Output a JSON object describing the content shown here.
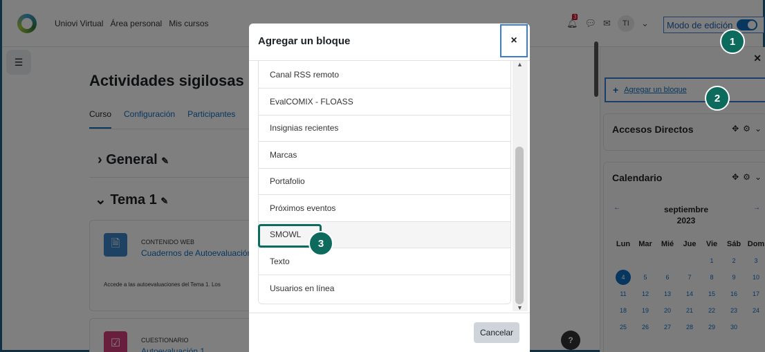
{
  "nav": {
    "links": [
      "Uniovi Virtual",
      "Área personal",
      "Mis cursos"
    ],
    "notifications_count": "3",
    "avatar_initials": "TI",
    "edit_mode_label": "Modo de edición",
    "edit_mode_on": true
  },
  "course": {
    "title": "Actividades sigilosas",
    "tabs": [
      "Curso",
      "Configuración",
      "Participantes"
    ],
    "active_tab": "Curso",
    "sections": [
      "General",
      "Tema 1"
    ]
  },
  "activities": [
    {
      "type": "CONTENIDO WEB",
      "name": "Cuadernos de Autoevaluación",
      "description": "Accede a las autoevaluaciones del Tema 1. Los"
    },
    {
      "type": "CUESTIONARIO",
      "name": "Autoevaluación 1"
    }
  ],
  "right_drawer": {
    "add_block_label": "Agregar un bloque",
    "blocks": {
      "accesos_title": "Accesos Directos",
      "calendar_title": "Calendario"
    },
    "calendar": {
      "month": "septiembre",
      "year": "2023",
      "weekdays": [
        "Lun",
        "Mar",
        "Mié",
        "Jue",
        "Vie",
        "Sáb",
        "Dom"
      ],
      "weeks": [
        [
          "",
          "",
          "",
          "",
          "1",
          "2",
          "3"
        ],
        [
          "4",
          "5",
          "6",
          "7",
          "8",
          "9",
          "10"
        ],
        [
          "11",
          "12",
          "13",
          "14",
          "15",
          "16",
          "17"
        ],
        [
          "18",
          "19",
          "20",
          "21",
          "22",
          "23",
          "24"
        ],
        [
          "25",
          "26",
          "27",
          "28",
          "29",
          "30",
          ""
        ]
      ],
      "today": "4"
    }
  },
  "modal": {
    "title": "Agregar un bloque",
    "close_symbol": "×",
    "items": [
      "Canal RSS remoto",
      "EvalCOMIX - FLOASS",
      "Insignias recientes",
      "Marcas",
      "Portafolio",
      "Próximos eventos",
      "SMOWL",
      "Texto",
      "Usuarios en línea"
    ],
    "highlighted_item": "SMOWL",
    "cancel_label": "Cancelar"
  },
  "help_label": "?",
  "steps": [
    "1",
    "2",
    "3"
  ],
  "colors": {
    "accent": "#0f6cbf",
    "step_marker": "#0c6b5c",
    "focus_outline": "#3a7bd5"
  }
}
